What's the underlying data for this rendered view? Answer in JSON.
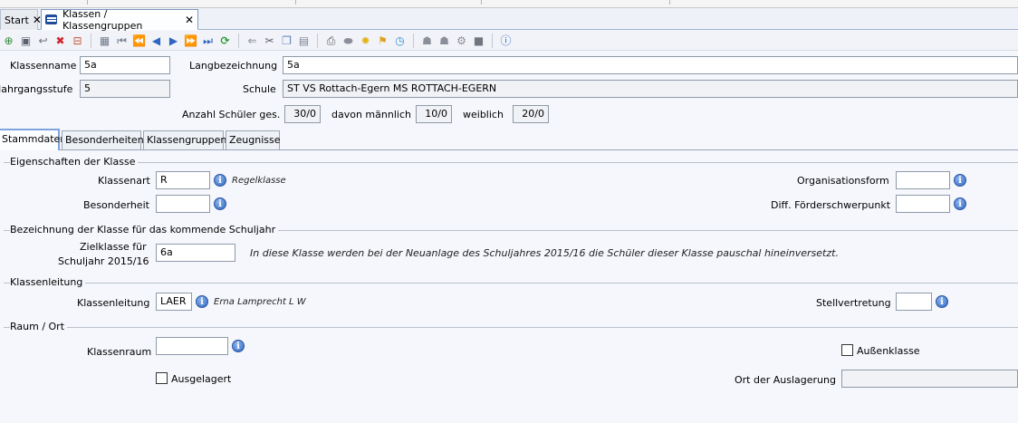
{
  "tabs": {
    "start": {
      "label": "Start"
    },
    "klassen": {
      "label": "Klassen / Klassengruppen"
    }
  },
  "toolbar": {
    "icons": [
      "add-icon",
      "save-icon",
      "undo-icon",
      "delete-icon",
      "cancel-icon",
      "grid-icon",
      "first-record-icon",
      "previous-page-icon",
      "previous-record-icon",
      "next-record-icon",
      "next-page-icon",
      "last-record-icon",
      "refresh-icon",
      "back-arrow-icon",
      "cut-icon",
      "copy-icon",
      "paste-icon",
      "print-icon",
      "preview-icon",
      "lightbulb-icon",
      "broom-icon",
      "clock-icon",
      "users-icon",
      "user-group-icon",
      "settings-icon",
      "book-icon",
      "help-icon"
    ]
  },
  "header": {
    "klassenname_label": "Klassenname",
    "klassenname_value": "5a",
    "langbezeichnung_label": "Langbezeichnung",
    "langbezeichnung_value": "5a",
    "jahrgangsstufe_label": "Jahrgangsstufe",
    "jahrgangsstufe_value": "5",
    "schule_label": "Schule",
    "schule_value": "ST VS Rottach-Egern MS ROTTACH-EGERN",
    "anzahl_label": "Anzahl Schüler ges.",
    "anzahl_value": "30/0",
    "maennlich_label": "davon männlich",
    "maennlich_value": "10/0",
    "weiblich_label": "weiblich",
    "weiblich_value": "20/0"
  },
  "subtabs": [
    "Stammdaten",
    "Besonderheiten",
    "Klassengruppen",
    "Zeugnisse"
  ],
  "eigenschaften": {
    "title": "Eigenschaften der Klasse",
    "klassenart_label": "Klassenart",
    "klassenart_value": "R",
    "klassenart_note": "Regelklasse",
    "besonderheit_label": "Besonderheit",
    "besonderheit_value": "",
    "organisationsform_label": "Organisationsform",
    "organisationsform_value": "",
    "diff_label": "Diff. Förderschwerpunkt",
    "diff_value": ""
  },
  "bezeichnung": {
    "title": "Bezeichnung der Klasse für das kommende Schuljahr",
    "zielklasse_label_1": "Zielklasse für",
    "zielklasse_label_2": "Schuljahr 2015/16",
    "zielklasse_value": "6a",
    "note": "In diese Klasse werden bei der Neuanlage des Schuljahres 2015/16 die Schüler dieser Klasse pauschal hineinversetzt."
  },
  "klassenleitung": {
    "title": "Klassenleitung",
    "label": "Klassenleitung",
    "value": "LAER",
    "note": "Erna Lamprecht L W",
    "stellvertretung_label": "Stellvertretung",
    "stellvertretung_value": ""
  },
  "raum": {
    "title": "Raum / Ort",
    "klassenraum_label": "Klassenraum",
    "klassenraum_value": "",
    "aussenklasse_label": "Außenklasse",
    "ausgelagert_label": "Ausgelagert",
    "ort_label": "Ort der Auslagerung",
    "ort_value": ""
  },
  "colors": {
    "info_blue": "#2f66c2",
    "tab_active_border": "#7fa4dc"
  }
}
